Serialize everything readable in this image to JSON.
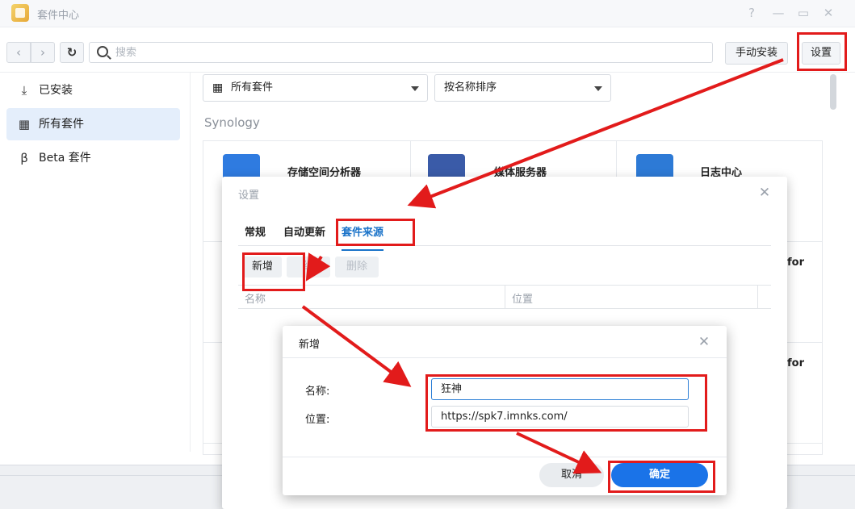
{
  "window": {
    "title": "套件中心",
    "help": "?",
    "minimize": "—",
    "maximize": "▭",
    "close": "✕"
  },
  "toolbar": {
    "back": "‹",
    "forward": "›",
    "refresh": "↻",
    "search_placeholder": "搜索",
    "manual_install": "手动安装",
    "settings": "设置"
  },
  "sidebar": {
    "items": [
      {
        "label": "已安装",
        "icon": "download-icon",
        "glyph": "⤓"
      },
      {
        "label": "所有套件",
        "icon": "grid-icon",
        "glyph": "▦"
      },
      {
        "label": "Beta 套件",
        "icon": "beta-icon",
        "glyph": "β"
      }
    ]
  },
  "filters": {
    "category": "所有套件",
    "sort": "按名称排序"
  },
  "section_title": "Synology",
  "packages": [
    {
      "name": "存储空间分析器"
    },
    {
      "name": "媒体服务器"
    },
    {
      "name": "日志中心"
    }
  ],
  "partial_text": [
    "for",
    "for"
  ],
  "settings_dialog": {
    "title": "设置",
    "close": "✕",
    "tabs": [
      "常规",
      "自动更新",
      "套件来源"
    ],
    "buttons": {
      "add": "新增",
      "edit": "编",
      "delete": "删除"
    },
    "columns": {
      "name": "名称",
      "location": "位置"
    }
  },
  "add_dialog": {
    "title": "新增",
    "close": "✕",
    "name_label": "名称:",
    "name_value": "狂神",
    "location_label": "位置:",
    "location_value": "https://spk7.imnks.com/",
    "cancel": "取消",
    "confirm": "确定"
  },
  "colors": {
    "annotation": "#e21b1b",
    "accent": "#1a73e8"
  }
}
